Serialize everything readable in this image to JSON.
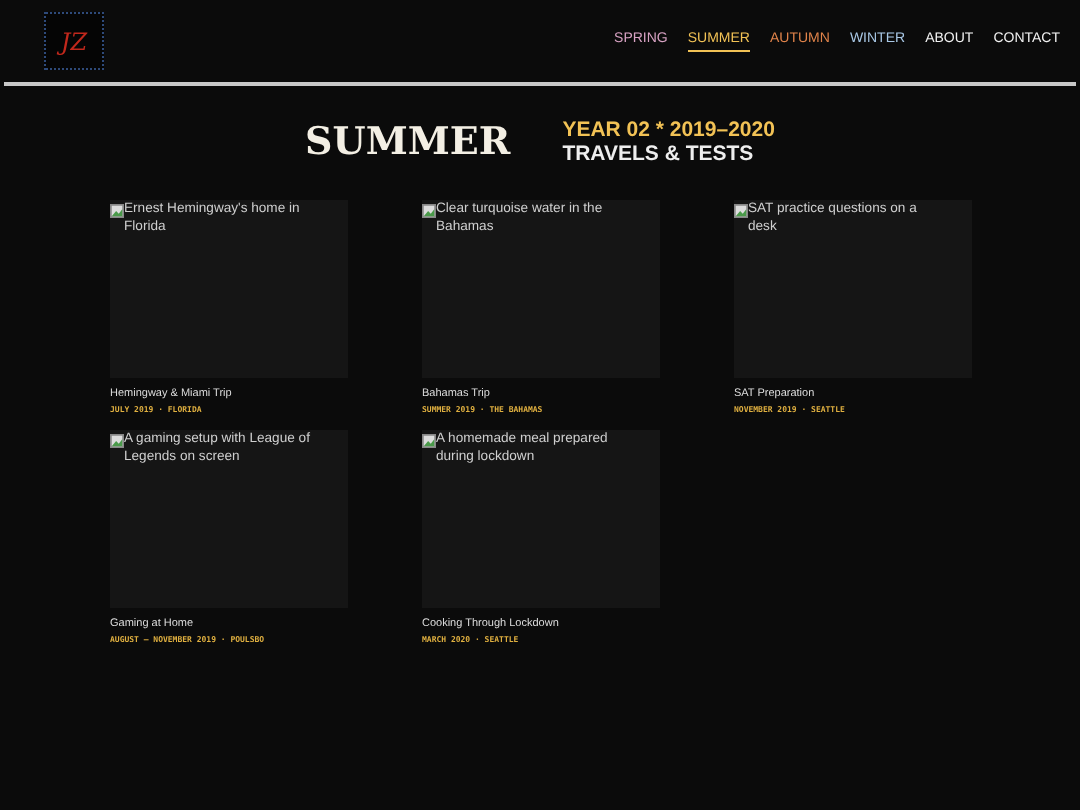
{
  "logo": {
    "text": "JZ"
  },
  "nav": [
    {
      "label": "SPRING",
      "color": "#d9a3c4",
      "selected": false
    },
    {
      "label": "SUMMER",
      "color": "#f2c255",
      "selected": true
    },
    {
      "label": "AUTUMN",
      "color": "#e0834a",
      "selected": false
    },
    {
      "label": "WINTER",
      "color": "#a9c8e6",
      "selected": false
    },
    {
      "label": "ABOUT",
      "color": "#f2f2f2",
      "selected": false
    },
    {
      "label": "CONTACT",
      "color": "#f2f2f2",
      "selected": false
    }
  ],
  "heading": {
    "title": "SUMMER",
    "year": "YEAR 02 * 2019–2020",
    "subtitle": "TRAVELS & TESTS"
  },
  "cards": [
    {
      "alt": "Ernest Hemingway's home in Florida",
      "title": "Hemingway & Miami Trip",
      "meta": "JULY 2019 · FLORIDA"
    },
    {
      "alt": "Clear turquoise water in the Bahamas",
      "title": "Bahamas Trip",
      "meta": "SUMMER 2019 · THE BAHAMAS"
    },
    {
      "alt": "SAT practice questions on a desk",
      "title": "SAT Preparation",
      "meta": "NOVEMBER 2019 · SEATTLE"
    },
    {
      "alt": "A gaming setup with League of Legends on screen",
      "title": "Gaming at Home",
      "meta": "AUGUST – NOVEMBER 2019 · POULSBO"
    },
    {
      "alt": "A homemade meal prepared during lockdown",
      "title": "Cooking Through Lockdown",
      "meta": "MARCH 2020 · SEATTLE"
    }
  ]
}
